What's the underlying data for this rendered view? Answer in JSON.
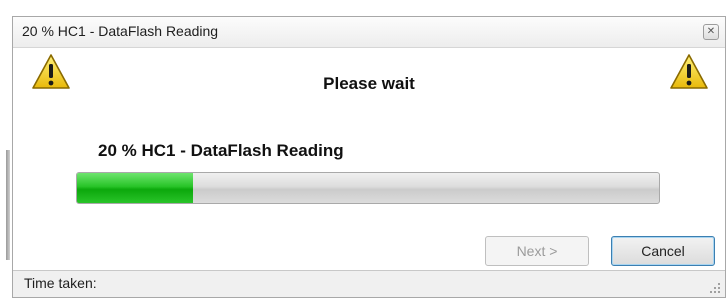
{
  "window": {
    "title": "20 % HC1 - DataFlash Reading",
    "close_glyph": "✕"
  },
  "main": {
    "heading": "Please wait",
    "status_label": "20 % HC1 - DataFlash Reading",
    "progress_fraction": 0.2
  },
  "buttons": {
    "next_label": "Next >",
    "cancel_label": "Cancel"
  },
  "statusbar": {
    "time_taken_label": "Time taken:"
  },
  "colors": {
    "progress_fill": "#1cb61c",
    "warning_yellow": "#f5d21c",
    "focus_border": "#3c7fb1"
  },
  "icons": {
    "warning": "warning-icon",
    "close": "close-icon",
    "resize_grip": "resize-grip-icon"
  }
}
